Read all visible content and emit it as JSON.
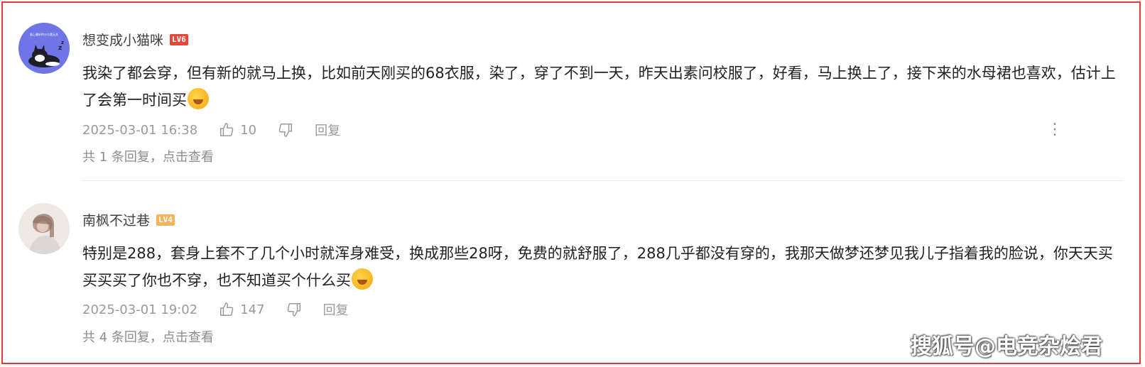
{
  "comments": [
    {
      "username": "想变成小猫咪",
      "level": "LV6",
      "level_color": "#e8473c",
      "avatar_text": "填上最好的沙与我无关",
      "text": "我染了都会穿，但有新的就马上换，比如前天刚买的68衣服，染了，穿了不到一天，昨天出素问校服了，好看，马上换上了，接下来的水母裙也喜欢，估计上了会第一时间买",
      "emoji": "laughing-emoji",
      "time": "2025-03-01 16:38",
      "likes": "10",
      "reply_label": "回复",
      "replies_text": "共 1 条回复，点击查看",
      "more": "⋮"
    },
    {
      "username": "南枫不过巷",
      "level": "LV4",
      "level_color": "#f5b45a",
      "text": "特别是288，套身上套不了几个小时就浑身难受，换成那些28呀，免费的就舒服了，288几乎都没有穿的，我那天做梦还梦见我儿子指着我的脸说，你天天买买买买了你也不穿，也不知道买个什么买",
      "emoji": "laughing-emoji",
      "time": "2025-03-01 19:02",
      "likes": "147",
      "reply_label": "回复",
      "replies_text": "共 4 条回复，点击查看"
    }
  ],
  "watermark": "搜狐号@电竞杂烩君"
}
